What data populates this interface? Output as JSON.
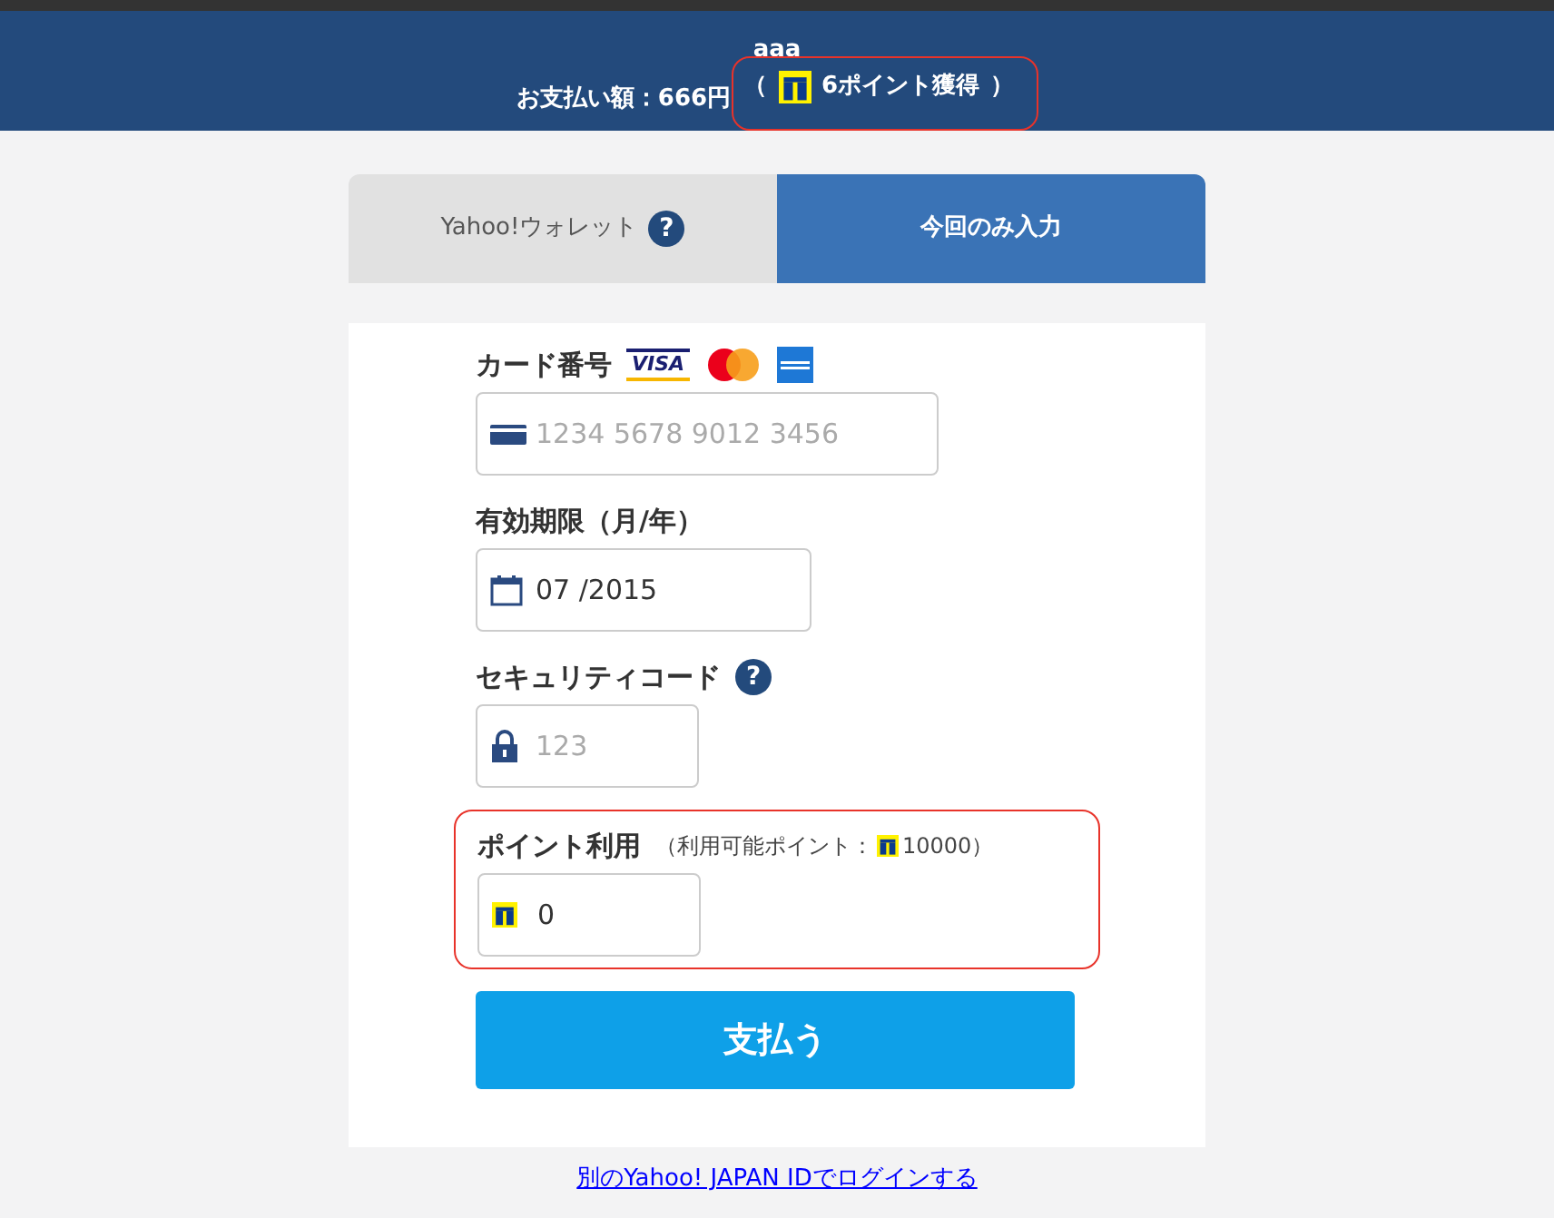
{
  "header": {
    "title": "aaa",
    "amount": "お支払い額：666円",
    "paren_open": "（",
    "points_earned": "6ポイント獲得",
    "paren_close": "）",
    "highlighted": true
  },
  "tabs": [
    {
      "label": "Yahoo!ウォレット",
      "help": "?",
      "selected": false
    },
    {
      "label": "今回のみ入力",
      "selected": true
    }
  ],
  "fields": [
    {
      "kind": "card",
      "label": "カード番号",
      "brands": [
        {
          "kind": "visa",
          "text": "VISA"
        },
        {
          "kind": "mastercard"
        },
        {
          "kind": "amex"
        }
      ],
      "placeholder": "1234 5678 9012 3456"
    },
    {
      "kind": "expiry",
      "label": "有効期限（月/年）",
      "value": "07 /2015"
    },
    {
      "kind": "cvc",
      "label": "セキュリティコード",
      "help": "?",
      "placeholder": "123"
    },
    {
      "kind": "points",
      "label": "ポイント利用",
      "note": "（利用可能ポイント：",
      "available": "10000）",
      "value": "0",
      "highlighted": true
    }
  ],
  "pay_button": "支払う",
  "login_link": "別のYahoo! JAPAN IDでログインする"
}
